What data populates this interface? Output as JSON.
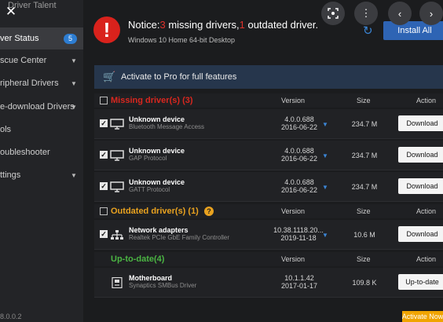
{
  "sidebar": {
    "app_title": "Driver Talent",
    "items": [
      {
        "label": "ver Status",
        "badge": "5"
      },
      {
        "label": "scue Center"
      },
      {
        "label": "ripheral Drivers"
      },
      {
        "label": "e-download Drivers"
      },
      {
        "label": "ols"
      },
      {
        "label": "oubleshooter"
      },
      {
        "label": "ttings"
      }
    ],
    "version": "8.0.0.2"
  },
  "notice": {
    "prefix": "Notice:",
    "missing_count": "3",
    "missing_text": " missing drivers,",
    "outdated_count": "1",
    "outdated_text": " outdated driver.",
    "os": "Windows 10 Home 64-bit Desktop",
    "install_all": "Install All"
  },
  "promo": {
    "text": "Activate to Pro for full features"
  },
  "columns": {
    "version": "Version",
    "size": "Size",
    "action": "Action"
  },
  "sections": {
    "missing": {
      "title": "Missing driver(s) (3)",
      "color": "#d9271f"
    },
    "outdated": {
      "title": "Outdated driver(s) (1)",
      "color": "#e9a21f"
    },
    "uptodate": {
      "title": "Up-to-date(4)",
      "color": "#4bb543"
    }
  },
  "missing_rows": [
    {
      "name": "Unknown device",
      "desc": "Bluetooth Message Access",
      "ver": "4.0.0.688",
      "date": "2016-06-22",
      "size": "234.7 M",
      "action": "Download"
    },
    {
      "name": "Unknown device",
      "desc": "GAP Protocol",
      "ver": "4.0.0.688",
      "date": "2016-06-22",
      "size": "234.7 M",
      "action": "Download"
    },
    {
      "name": "Unknown device",
      "desc": "GATT Protocol",
      "ver": "4.0.0.688",
      "date": "2016-06-22",
      "size": "234.7 M",
      "action": "Download"
    }
  ],
  "outdated_rows": [
    {
      "name": "Network adapters",
      "desc": "Realtek PCIe GbE Family Controller",
      "ver": "10.38.1118.20...",
      "date": "2019-11-18",
      "size": "10.6 M",
      "action": "Download"
    }
  ],
  "uptodate_rows": [
    {
      "name": "Motherboard",
      "desc": "Synaptics SMBus Driver",
      "ver": "10.1.1.42",
      "date": "2017-01-17",
      "size": "109.8 K",
      "action": "Up-to-date"
    }
  ],
  "footer": {
    "activate": "Activate Now"
  },
  "icons": {
    "close": "close-icon",
    "scan": "scan-icon",
    "more": "more-icon",
    "prev": "chevron-left-icon",
    "next": "chevron-right-icon",
    "cart": "cart-icon",
    "refresh": "refresh-icon",
    "help": "help-icon"
  }
}
